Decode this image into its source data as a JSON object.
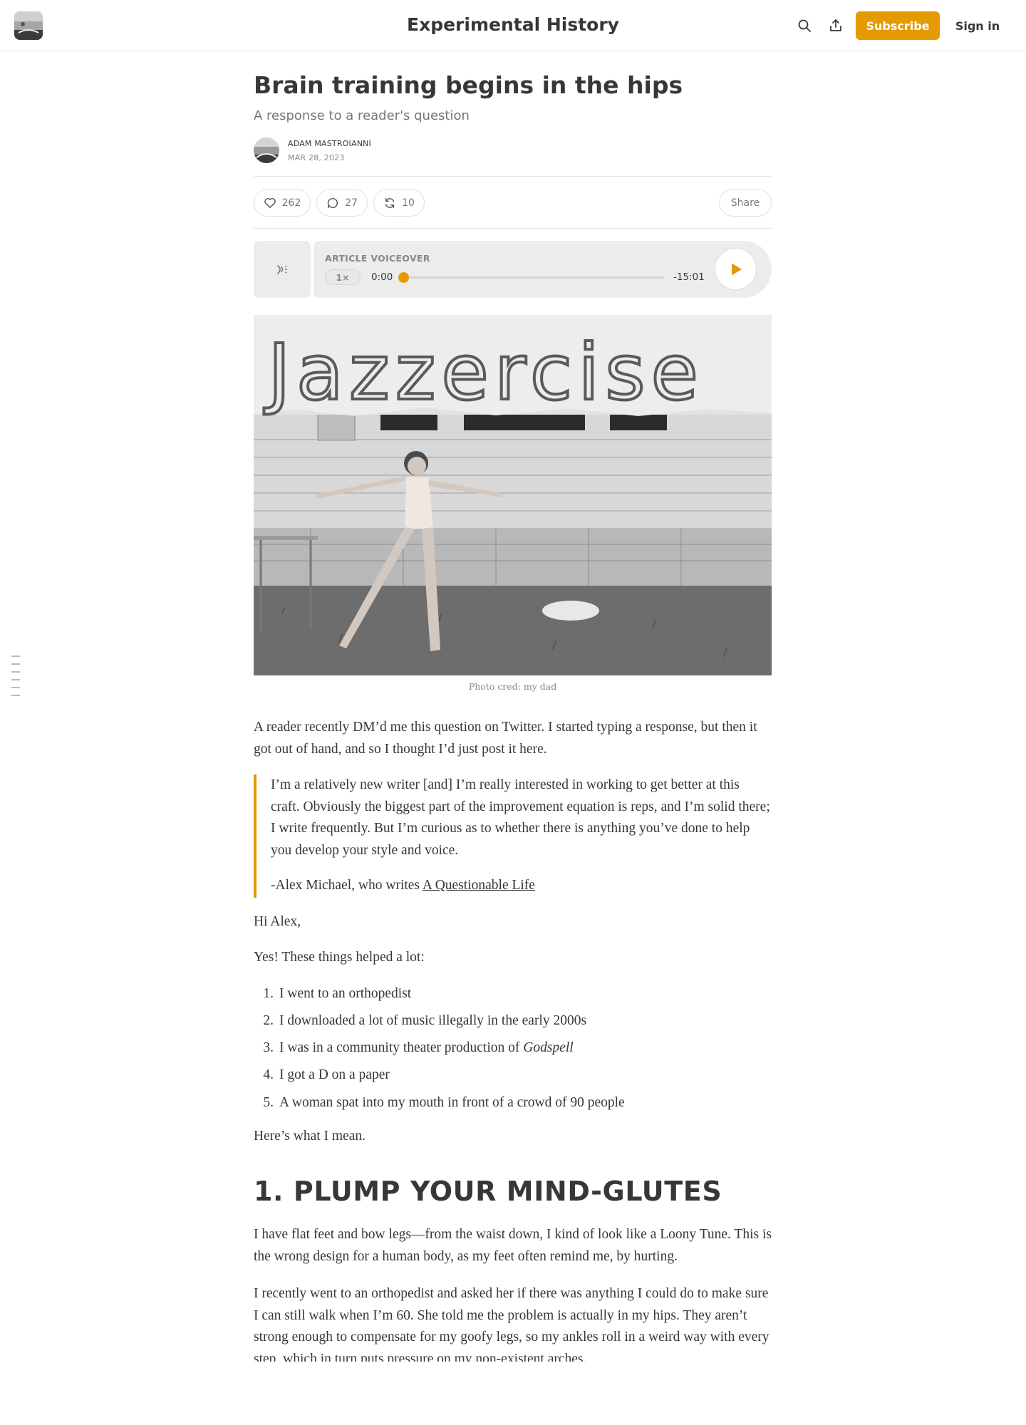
{
  "navbar": {
    "publication": "Experimental History",
    "subscribe_label": "Subscribe",
    "signin_label": "Sign in",
    "icons": [
      "search-icon",
      "share-icon"
    ]
  },
  "post": {
    "title": "Brain training begins in the hips",
    "subtitle": "A response to a reader's question",
    "author": "ADAM MASTROIANNI",
    "date": "MAR 28, 2023",
    "likes": "262",
    "comments": "27",
    "restacks": "10",
    "share_label": "Share"
  },
  "voiceover": {
    "label": "ARTICLE VOICEOVER",
    "speed": "1×",
    "current_time": "0:00",
    "remaining_time": "-15:01",
    "progress": 0,
    "accent": "#e49a00"
  },
  "hero": {
    "banner_text": "Jazzercise",
    "caption": "Photo cred: my dad"
  },
  "body": {
    "intro": "A reader recently DM’d me this question on Twitter. I started typing a response, but then it got out of hand, and so I thought I’d just post it here.",
    "quote": "I’m a relatively new writer [and] I’m really interested in working to get better at this craft. Obviously the biggest part of the improvement equation is reps, and I’m solid there; I write frequently. But I’m curious as to whether there is anything you’ve done to help you develop your style and voice.",
    "quote_attribution": "-Alex Michael, who writes ",
    "quote_link": "A Questionable Life",
    "greeting": "Hi Alex,",
    "lead": "Yes! These things helped a lot:",
    "list": [
      {
        "num": "1.",
        "text": "I went to an orthopedist"
      },
      {
        "num": "2.",
        "text": "I downloaded a lot of music illegally in the early 2000s"
      },
      {
        "num": "3.",
        "text": "I was in a community theater production of ",
        "em": "Godspell"
      },
      {
        "num": "4.",
        "text": "I got a D on a paper"
      },
      {
        "num": "5.",
        "text": "A woman spat into my mouth in front of a crowd of 90 people"
      }
    ],
    "outro": "Here’s what I mean.",
    "heading": "1. PLUMP YOUR MIND-GLUTES",
    "p1": "I have flat feet and bow legs—from the waist down, I kind of look like a Loony Tune. This is the wrong design for a human body, as my feet often remind me, by hurting.",
    "p2": "I recently went to an orthopedist and asked her if there was anything I could do to make sure I can still walk when I’m 60. She told me the problem is actually in my hips. They aren’t strong enough to compensate for my goofy legs, so my ankles roll in a weird way with every step, which in turn puts pressure on my non-existent arches."
  }
}
